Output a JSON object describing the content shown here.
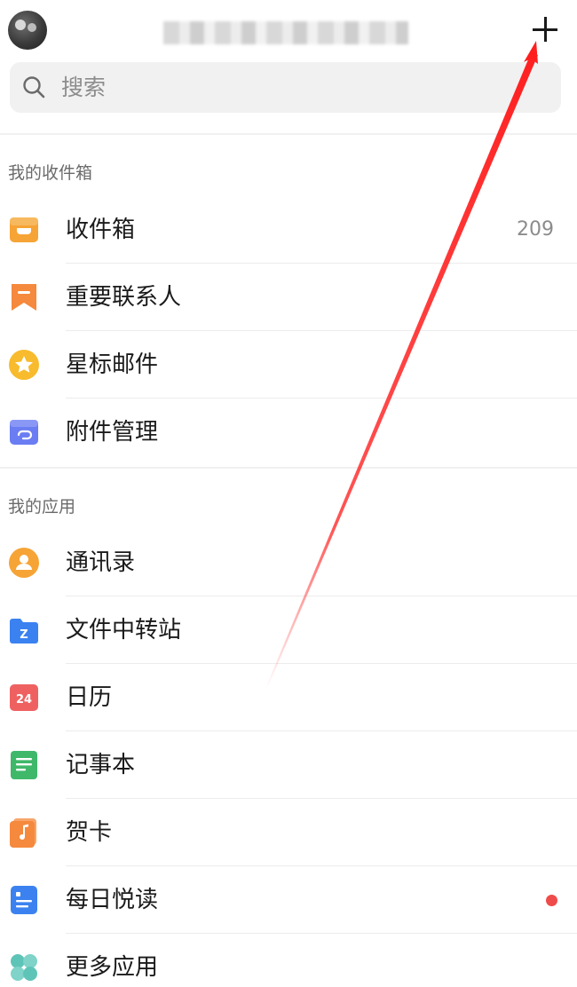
{
  "header": {
    "add_icon": "plus-icon"
  },
  "search": {
    "placeholder": "搜索",
    "icon": "search-icon"
  },
  "mailboxes": {
    "title": "我的收件箱",
    "items": [
      {
        "label": "收件箱",
        "icon": "inbox-icon",
        "count": "209",
        "color": "#f6a436"
      },
      {
        "label": "重要联系人",
        "icon": "bookmark-icon",
        "color": "#f5893d"
      },
      {
        "label": "星标邮件",
        "icon": "star-icon",
        "color": "#f7bb2d"
      },
      {
        "label": "附件管理",
        "icon": "attachment-icon",
        "color": "#6b7df2"
      }
    ]
  },
  "apps": {
    "title": "我的应用",
    "items": [
      {
        "label": "通讯录",
        "icon": "contacts-icon",
        "color": "#f6a436"
      },
      {
        "label": "文件中转站",
        "icon": "folder-icon",
        "color": "#3b82f0"
      },
      {
        "label": "日历",
        "icon": "calendar-icon",
        "calendar_day": "24",
        "color": "#ef6161"
      },
      {
        "label": "记事本",
        "icon": "notepad-icon",
        "color": "#3fb86a"
      },
      {
        "label": "贺卡",
        "icon": "greeting-card-icon",
        "color": "#f5893d"
      },
      {
        "label": "每日悦读",
        "icon": "reading-icon",
        "color": "#3b82f0",
        "has_notification": true
      },
      {
        "label": "更多应用",
        "icon": "more-apps-icon",
        "color": "#5fc4b8"
      }
    ]
  },
  "colors": {
    "accent": "#ef4b4b",
    "annotation_arrow": "#ff2a2a"
  }
}
